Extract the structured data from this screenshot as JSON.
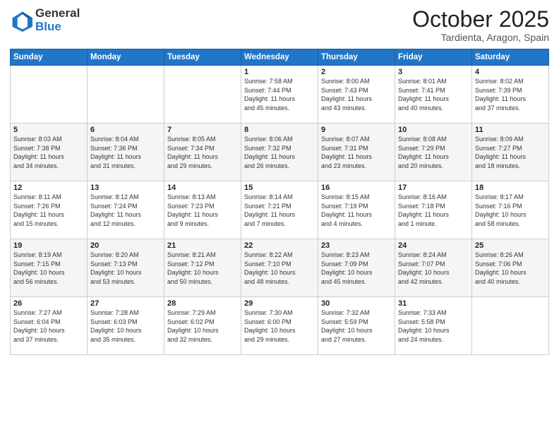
{
  "header": {
    "logo_general": "General",
    "logo_blue": "Blue",
    "month_title": "October 2025",
    "location": "Tardienta, Aragon, Spain"
  },
  "days_of_week": [
    "Sunday",
    "Monday",
    "Tuesday",
    "Wednesday",
    "Thursday",
    "Friday",
    "Saturday"
  ],
  "weeks": [
    [
      {
        "day": "",
        "info": ""
      },
      {
        "day": "",
        "info": ""
      },
      {
        "day": "",
        "info": ""
      },
      {
        "day": "1",
        "info": "Sunrise: 7:58 AM\nSunset: 7:44 PM\nDaylight: 11 hours\nand 45 minutes."
      },
      {
        "day": "2",
        "info": "Sunrise: 8:00 AM\nSunset: 7:43 PM\nDaylight: 11 hours\nand 43 minutes."
      },
      {
        "day": "3",
        "info": "Sunrise: 8:01 AM\nSunset: 7:41 PM\nDaylight: 11 hours\nand 40 minutes."
      },
      {
        "day": "4",
        "info": "Sunrise: 8:02 AM\nSunset: 7:39 PM\nDaylight: 11 hours\nand 37 minutes."
      }
    ],
    [
      {
        "day": "5",
        "info": "Sunrise: 8:03 AM\nSunset: 7:38 PM\nDaylight: 11 hours\nand 34 minutes."
      },
      {
        "day": "6",
        "info": "Sunrise: 8:04 AM\nSunset: 7:36 PM\nDaylight: 11 hours\nand 31 minutes."
      },
      {
        "day": "7",
        "info": "Sunrise: 8:05 AM\nSunset: 7:34 PM\nDaylight: 11 hours\nand 29 minutes."
      },
      {
        "day": "8",
        "info": "Sunrise: 8:06 AM\nSunset: 7:32 PM\nDaylight: 11 hours\nand 26 minutes."
      },
      {
        "day": "9",
        "info": "Sunrise: 8:07 AM\nSunset: 7:31 PM\nDaylight: 11 hours\nand 23 minutes."
      },
      {
        "day": "10",
        "info": "Sunrise: 8:08 AM\nSunset: 7:29 PM\nDaylight: 11 hours\nand 20 minutes."
      },
      {
        "day": "11",
        "info": "Sunrise: 8:09 AM\nSunset: 7:27 PM\nDaylight: 11 hours\nand 18 minutes."
      }
    ],
    [
      {
        "day": "12",
        "info": "Sunrise: 8:11 AM\nSunset: 7:26 PM\nDaylight: 11 hours\nand 15 minutes."
      },
      {
        "day": "13",
        "info": "Sunrise: 8:12 AM\nSunset: 7:24 PM\nDaylight: 11 hours\nand 12 minutes."
      },
      {
        "day": "14",
        "info": "Sunrise: 8:13 AM\nSunset: 7:23 PM\nDaylight: 11 hours\nand 9 minutes."
      },
      {
        "day": "15",
        "info": "Sunrise: 8:14 AM\nSunset: 7:21 PM\nDaylight: 11 hours\nand 7 minutes."
      },
      {
        "day": "16",
        "info": "Sunrise: 8:15 AM\nSunset: 7:19 PM\nDaylight: 11 hours\nand 4 minutes."
      },
      {
        "day": "17",
        "info": "Sunrise: 8:16 AM\nSunset: 7:18 PM\nDaylight: 11 hours\nand 1 minute."
      },
      {
        "day": "18",
        "info": "Sunrise: 8:17 AM\nSunset: 7:16 PM\nDaylight: 10 hours\nand 58 minutes."
      }
    ],
    [
      {
        "day": "19",
        "info": "Sunrise: 8:19 AM\nSunset: 7:15 PM\nDaylight: 10 hours\nand 56 minutes."
      },
      {
        "day": "20",
        "info": "Sunrise: 8:20 AM\nSunset: 7:13 PM\nDaylight: 10 hours\nand 53 minutes."
      },
      {
        "day": "21",
        "info": "Sunrise: 8:21 AM\nSunset: 7:12 PM\nDaylight: 10 hours\nand 50 minutes."
      },
      {
        "day": "22",
        "info": "Sunrise: 8:22 AM\nSunset: 7:10 PM\nDaylight: 10 hours\nand 48 minutes."
      },
      {
        "day": "23",
        "info": "Sunrise: 8:23 AM\nSunset: 7:09 PM\nDaylight: 10 hours\nand 45 minutes."
      },
      {
        "day": "24",
        "info": "Sunrise: 8:24 AM\nSunset: 7:07 PM\nDaylight: 10 hours\nand 42 minutes."
      },
      {
        "day": "25",
        "info": "Sunrise: 8:26 AM\nSunset: 7:06 PM\nDaylight: 10 hours\nand 40 minutes."
      }
    ],
    [
      {
        "day": "26",
        "info": "Sunrise: 7:27 AM\nSunset: 6:04 PM\nDaylight: 10 hours\nand 37 minutes."
      },
      {
        "day": "27",
        "info": "Sunrise: 7:28 AM\nSunset: 6:03 PM\nDaylight: 10 hours\nand 35 minutes."
      },
      {
        "day": "28",
        "info": "Sunrise: 7:29 AM\nSunset: 6:02 PM\nDaylight: 10 hours\nand 32 minutes."
      },
      {
        "day": "29",
        "info": "Sunrise: 7:30 AM\nSunset: 6:00 PM\nDaylight: 10 hours\nand 29 minutes."
      },
      {
        "day": "30",
        "info": "Sunrise: 7:32 AM\nSunset: 5:59 PM\nDaylight: 10 hours\nand 27 minutes."
      },
      {
        "day": "31",
        "info": "Sunrise: 7:33 AM\nSunset: 5:58 PM\nDaylight: 10 hours\nand 24 minutes."
      },
      {
        "day": "",
        "info": ""
      }
    ]
  ]
}
